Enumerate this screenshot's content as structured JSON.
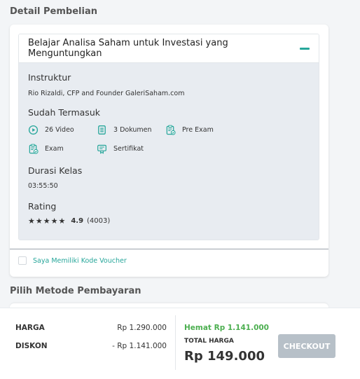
{
  "page": {
    "title": "Detail Pembelian",
    "payment_title": "Pilih Metode Pembayaran"
  },
  "course": {
    "title": "Belajar Analisa Saham untuk Investasi yang Menguntungkan",
    "instructor_label": "Instruktur",
    "instructor_value": "Rio Rizaldi, CFP and Founder GaleriSaham.com",
    "includes_label": "Sudah Termasuk",
    "includes": [
      {
        "icon": "play-circle-icon",
        "text": "26 Video"
      },
      {
        "icon": "document-icon",
        "text": "3 Dokumen"
      },
      {
        "icon": "clipboard-check-icon",
        "text": "Pre Exam"
      },
      {
        "icon": "clipboard-check-icon",
        "text": "Exam"
      },
      {
        "icon": "certificate-icon",
        "text": "Sertifikat"
      }
    ],
    "duration_label": "Durasi Kelas",
    "duration_value": "03:55:50",
    "rating_label": "Rating",
    "rating_stars": "★★★★★",
    "rating_value": "4.9",
    "rating_count": "(4003)"
  },
  "voucher": {
    "label": "Saya Memiliki Kode Voucher",
    "checked": false
  },
  "summary": {
    "harga_label": "HARGA",
    "harga_value": "Rp 1.290.000",
    "diskon_label": "DISKON",
    "diskon_value": "- Rp 1.141.000",
    "hemat": "Hemat Rp 1.141.000",
    "total_label": "TOTAL HARGA",
    "total_value": "Rp 149.000",
    "checkout_label": "CHECKOUT"
  },
  "colors": {
    "accent": "#26a69a",
    "savings": "#4caf50",
    "button_disabled": "#b7c0c8"
  }
}
